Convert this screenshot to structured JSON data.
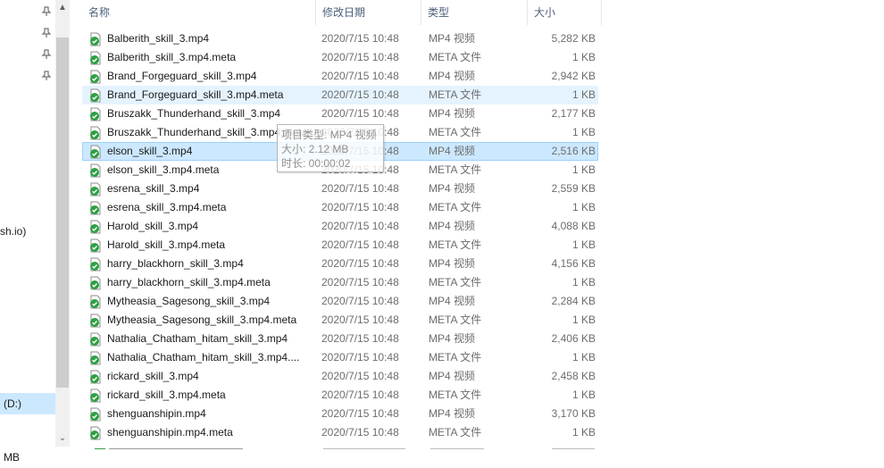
{
  "nav": {
    "partial_label": "sh.io)",
    "drive_label": "(D:)",
    "pinned_icon": "pin-icon"
  },
  "header": {
    "name": "名称",
    "date": "修改日期",
    "type": "类型",
    "size": "大小"
  },
  "files": [
    {
      "name": "Balberith_skill_3.mp4",
      "date": "2020/7/15 10:48",
      "type": "MP4 视频",
      "size": "5,282 KB",
      "state": ""
    },
    {
      "name": "Balberith_skill_3.mp4.meta",
      "date": "2020/7/15 10:48",
      "type": "META 文件",
      "size": "1 KB",
      "state": ""
    },
    {
      "name": "Brand_Forgeguard_skill_3.mp4",
      "date": "2020/7/15 10:48",
      "type": "MP4 视频",
      "size": "2,942 KB",
      "state": ""
    },
    {
      "name": "Brand_Forgeguard_skill_3.mp4.meta",
      "date": "2020/7/15 10:48",
      "type": "META 文件",
      "size": "1 KB",
      "state": "hover"
    },
    {
      "name": "Bruszakk_Thunderhand_skill_3.mp4",
      "date": "2020/7/15 10:48",
      "type": "MP4 视频",
      "size": "2,177 KB",
      "state": ""
    },
    {
      "name": "Bruszakk_Thunderhand_skill_3.mp4.meta",
      "date": "2020/7/15 10:48",
      "type": "META 文件",
      "size": "1 KB",
      "state": ""
    },
    {
      "name": "elson_skill_3.mp4",
      "date": "2020/7/15 10:48",
      "type": "MP4 视频",
      "size": "2,516 KB",
      "state": "selected"
    },
    {
      "name": "elson_skill_3.mp4.meta",
      "date": "2020/7/15 10:48",
      "type": "META 文件",
      "size": "1 KB",
      "state": ""
    },
    {
      "name": "esrena_skill_3.mp4",
      "date": "2020/7/15 10:48",
      "type": "MP4 视频",
      "size": "2,559 KB",
      "state": ""
    },
    {
      "name": "esrena_skill_3.mp4.meta",
      "date": "2020/7/15 10:48",
      "type": "META 文件",
      "size": "1 KB",
      "state": ""
    },
    {
      "name": "Harold_skill_3.mp4",
      "date": "2020/7/15 10:48",
      "type": "MP4 视频",
      "size": "4,088 KB",
      "state": ""
    },
    {
      "name": "Harold_skill_3.mp4.meta",
      "date": "2020/7/15 10:48",
      "type": "META 文件",
      "size": "1 KB",
      "state": ""
    },
    {
      "name": "harry_blackhorn_skill_3.mp4",
      "date": "2020/7/15 10:48",
      "type": "MP4 视频",
      "size": "4,156 KB",
      "state": ""
    },
    {
      "name": "harry_blackhorn_skill_3.mp4.meta",
      "date": "2020/7/15 10:48",
      "type": "META 文件",
      "size": "1 KB",
      "state": ""
    },
    {
      "name": "Mytheasia_Sagesong_skill_3.mp4",
      "date": "2020/7/15 10:48",
      "type": "MP4 视频",
      "size": "2,284 KB",
      "state": ""
    },
    {
      "name": "Mytheasia_Sagesong_skill_3.mp4.meta",
      "date": "2020/7/15 10:48",
      "type": "META 文件",
      "size": "1 KB",
      "state": ""
    },
    {
      "name": "Nathalia_Chatham_hitam_skill_3.mp4",
      "date": "2020/7/15 10:48",
      "type": "MP4 视频",
      "size": "2,406 KB",
      "state": ""
    },
    {
      "name": "Nathalia_Chatham_hitam_skill_3.mp4....",
      "date": "2020/7/15 10:48",
      "type": "META 文件",
      "size": "1 KB",
      "state": ""
    },
    {
      "name": "rickard_skill_3.mp4",
      "date": "2020/7/15 10:48",
      "type": "MP4 视频",
      "size": "2,458 KB",
      "state": ""
    },
    {
      "name": "rickard_skill_3.mp4.meta",
      "date": "2020/7/15 10:48",
      "type": "META 文件",
      "size": "1 KB",
      "state": ""
    },
    {
      "name": "shenguanshipin.mp4",
      "date": "2020/7/15 10:48",
      "type": "MP4 视频",
      "size": "3,170 KB",
      "state": ""
    },
    {
      "name": "shenguanshipin.mp4.meta",
      "date": "2020/7/15 10:48",
      "type": "META 文件",
      "size": "1 KB",
      "state": ""
    }
  ],
  "tooltip": {
    "type_line": "项目类型: MP4 视频",
    "size_line": "大小: 2.12 MB",
    "duration_line": "时长: 00:00:02"
  },
  "status": {
    "size_text": "MB"
  },
  "icons": {
    "file": "file-synced-icon",
    "check_color": "#2ea043"
  }
}
